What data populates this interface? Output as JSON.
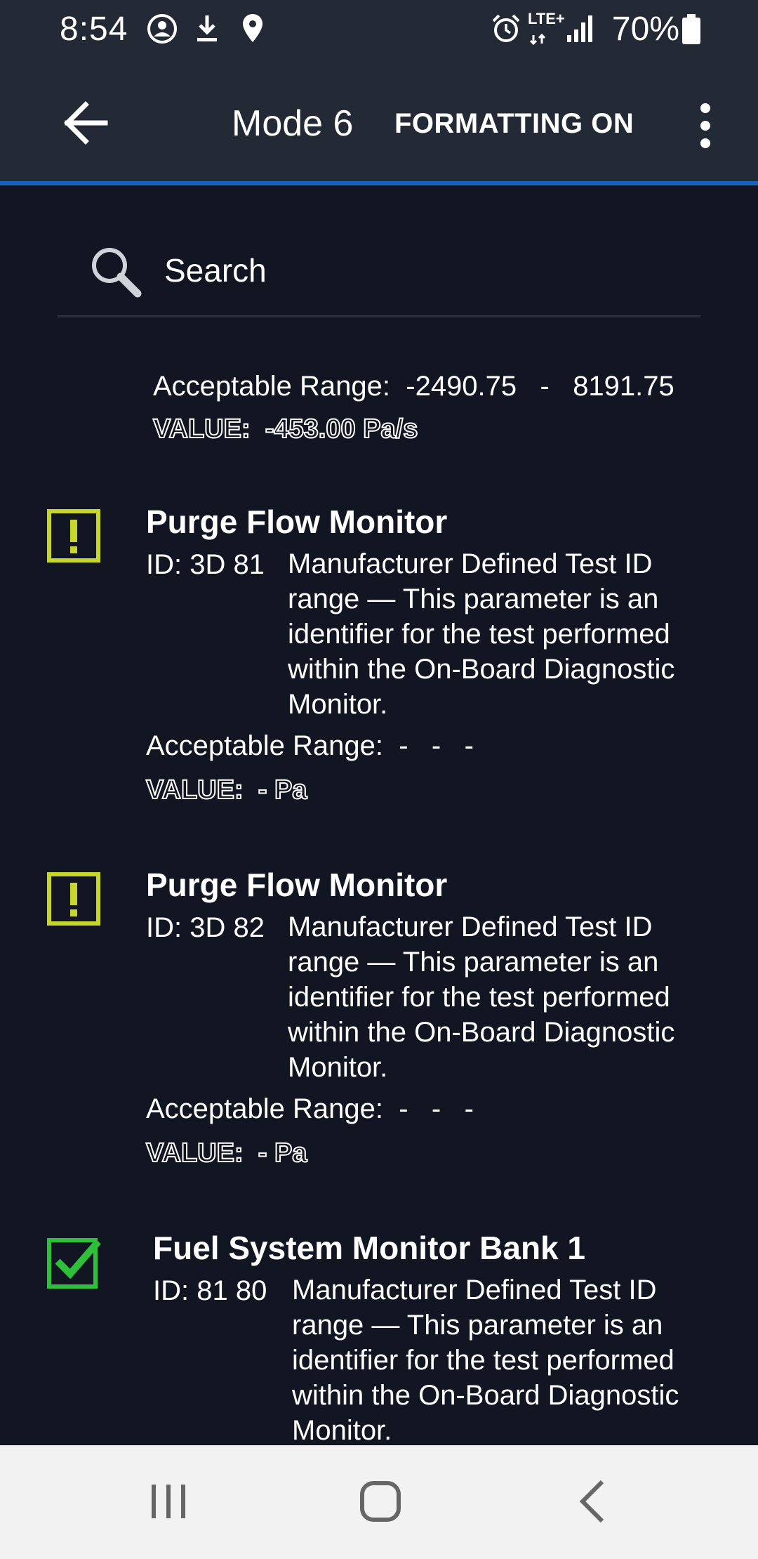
{
  "status_bar": {
    "time": "8:54",
    "network": "LTE+",
    "battery": "70%"
  },
  "app_bar": {
    "title": "Mode 6",
    "formatting_toggle": "FORMATTING ON"
  },
  "search": {
    "placeholder": "Search"
  },
  "partial_item": {
    "range_label": "Acceptable Range:",
    "range_min": "-2490.75",
    "range_sep": "-",
    "range_max": "8191.75",
    "value_label": "VALUE:",
    "value": "-453.00 Pa/s"
  },
  "items": [
    {
      "status": "warning",
      "title": "Purge Flow Monitor",
      "id_label": "ID:",
      "id": "3D 81",
      "description": "Manufacturer Defined Test ID range — This parameter is an identifier for the test performed within the On-Board Diagnostic Monitor.",
      "range_label": "Acceptable Range:",
      "range_text": "-   -   -",
      "value_label": "VALUE:",
      "value": "- Pa"
    },
    {
      "status": "warning",
      "title": "Purge Flow Monitor",
      "id_label": "ID:",
      "id": "3D 82",
      "description": "Manufacturer Defined Test ID range — This parameter is an identifier for the test performed within the On-Board Diagnostic Monitor.",
      "range_label": "Acceptable Range:",
      "range_text": "-   -   -",
      "value_label": "VALUE:",
      "value": "- Pa"
    },
    {
      "status": "pass",
      "title": "Fuel System Monitor Bank 1",
      "id_label": "ID:",
      "id": "81 80",
      "description": "Manufacturer Defined Test ID range — This parameter is an identifier for the test performed within the On-Board Diagnostic Monitor."
    }
  ],
  "colors": {
    "background": "#121623",
    "app_bar": "#232935",
    "accent": "#1565c0",
    "warning": "#c6d62a",
    "pass": "#2fbf3a"
  },
  "icons": {
    "back": "arrow-left-icon",
    "overflow": "more-vert-icon",
    "search": "search-icon",
    "warning": "warning-box-icon",
    "pass": "check-box-icon"
  }
}
